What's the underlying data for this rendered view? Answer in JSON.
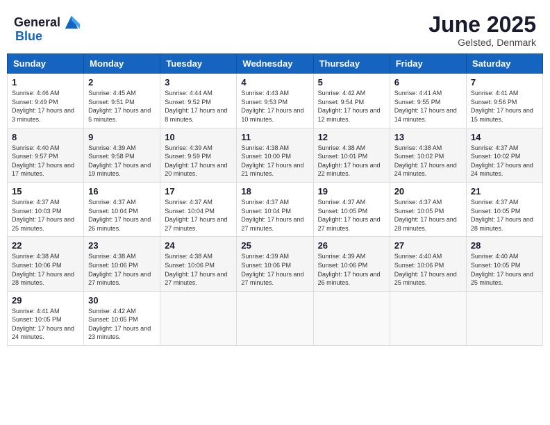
{
  "header": {
    "logo_general": "General",
    "logo_blue": "Blue",
    "month": "June 2025",
    "location": "Gelsted, Denmark"
  },
  "days_of_week": [
    "Sunday",
    "Monday",
    "Tuesday",
    "Wednesday",
    "Thursday",
    "Friday",
    "Saturday"
  ],
  "weeks": [
    [
      {
        "day": "1",
        "sunrise": "Sunrise: 4:46 AM",
        "sunset": "Sunset: 9:49 PM",
        "daylight": "Daylight: 17 hours and 3 minutes."
      },
      {
        "day": "2",
        "sunrise": "Sunrise: 4:45 AM",
        "sunset": "Sunset: 9:51 PM",
        "daylight": "Daylight: 17 hours and 5 minutes."
      },
      {
        "day": "3",
        "sunrise": "Sunrise: 4:44 AM",
        "sunset": "Sunset: 9:52 PM",
        "daylight": "Daylight: 17 hours and 8 minutes."
      },
      {
        "day": "4",
        "sunrise": "Sunrise: 4:43 AM",
        "sunset": "Sunset: 9:53 PM",
        "daylight": "Daylight: 17 hours and 10 minutes."
      },
      {
        "day": "5",
        "sunrise": "Sunrise: 4:42 AM",
        "sunset": "Sunset: 9:54 PM",
        "daylight": "Daylight: 17 hours and 12 minutes."
      },
      {
        "day": "6",
        "sunrise": "Sunrise: 4:41 AM",
        "sunset": "Sunset: 9:55 PM",
        "daylight": "Daylight: 17 hours and 14 minutes."
      },
      {
        "day": "7",
        "sunrise": "Sunrise: 4:41 AM",
        "sunset": "Sunset: 9:56 PM",
        "daylight": "Daylight: 17 hours and 15 minutes."
      }
    ],
    [
      {
        "day": "8",
        "sunrise": "Sunrise: 4:40 AM",
        "sunset": "Sunset: 9:57 PM",
        "daylight": "Daylight: 17 hours and 17 minutes."
      },
      {
        "day": "9",
        "sunrise": "Sunrise: 4:39 AM",
        "sunset": "Sunset: 9:58 PM",
        "daylight": "Daylight: 17 hours and 19 minutes."
      },
      {
        "day": "10",
        "sunrise": "Sunrise: 4:39 AM",
        "sunset": "Sunset: 9:59 PM",
        "daylight": "Daylight: 17 hours and 20 minutes."
      },
      {
        "day": "11",
        "sunrise": "Sunrise: 4:38 AM",
        "sunset": "Sunset: 10:00 PM",
        "daylight": "Daylight: 17 hours and 21 minutes."
      },
      {
        "day": "12",
        "sunrise": "Sunrise: 4:38 AM",
        "sunset": "Sunset: 10:01 PM",
        "daylight": "Daylight: 17 hours and 22 minutes."
      },
      {
        "day": "13",
        "sunrise": "Sunrise: 4:38 AM",
        "sunset": "Sunset: 10:02 PM",
        "daylight": "Daylight: 17 hours and 24 minutes."
      },
      {
        "day": "14",
        "sunrise": "Sunrise: 4:37 AM",
        "sunset": "Sunset: 10:02 PM",
        "daylight": "Daylight: 17 hours and 24 minutes."
      }
    ],
    [
      {
        "day": "15",
        "sunrise": "Sunrise: 4:37 AM",
        "sunset": "Sunset: 10:03 PM",
        "daylight": "Daylight: 17 hours and 25 minutes."
      },
      {
        "day": "16",
        "sunrise": "Sunrise: 4:37 AM",
        "sunset": "Sunset: 10:04 PM",
        "daylight": "Daylight: 17 hours and 26 minutes."
      },
      {
        "day": "17",
        "sunrise": "Sunrise: 4:37 AM",
        "sunset": "Sunset: 10:04 PM",
        "daylight": "Daylight: 17 hours and 27 minutes."
      },
      {
        "day": "18",
        "sunrise": "Sunrise: 4:37 AM",
        "sunset": "Sunset: 10:04 PM",
        "daylight": "Daylight: 17 hours and 27 minutes."
      },
      {
        "day": "19",
        "sunrise": "Sunrise: 4:37 AM",
        "sunset": "Sunset: 10:05 PM",
        "daylight": "Daylight: 17 hours and 27 minutes."
      },
      {
        "day": "20",
        "sunrise": "Sunrise: 4:37 AM",
        "sunset": "Sunset: 10:05 PM",
        "daylight": "Daylight: 17 hours and 28 minutes."
      },
      {
        "day": "21",
        "sunrise": "Sunrise: 4:37 AM",
        "sunset": "Sunset: 10:05 PM",
        "daylight": "Daylight: 17 hours and 28 minutes."
      }
    ],
    [
      {
        "day": "22",
        "sunrise": "Sunrise: 4:38 AM",
        "sunset": "Sunset: 10:06 PM",
        "daylight": "Daylight: 17 hours and 28 minutes."
      },
      {
        "day": "23",
        "sunrise": "Sunrise: 4:38 AM",
        "sunset": "Sunset: 10:06 PM",
        "daylight": "Daylight: 17 hours and 27 minutes."
      },
      {
        "day": "24",
        "sunrise": "Sunrise: 4:38 AM",
        "sunset": "Sunset: 10:06 PM",
        "daylight": "Daylight: 17 hours and 27 minutes."
      },
      {
        "day": "25",
        "sunrise": "Sunrise: 4:39 AM",
        "sunset": "Sunset: 10:06 PM",
        "daylight": "Daylight: 17 hours and 27 minutes."
      },
      {
        "day": "26",
        "sunrise": "Sunrise: 4:39 AM",
        "sunset": "Sunset: 10:06 PM",
        "daylight": "Daylight: 17 hours and 26 minutes."
      },
      {
        "day": "27",
        "sunrise": "Sunrise: 4:40 AM",
        "sunset": "Sunset: 10:06 PM",
        "daylight": "Daylight: 17 hours and 25 minutes."
      },
      {
        "day": "28",
        "sunrise": "Sunrise: 4:40 AM",
        "sunset": "Sunset: 10:05 PM",
        "daylight": "Daylight: 17 hours and 25 minutes."
      }
    ],
    [
      {
        "day": "29",
        "sunrise": "Sunrise: 4:41 AM",
        "sunset": "Sunset: 10:05 PM",
        "daylight": "Daylight: 17 hours and 24 minutes."
      },
      {
        "day": "30",
        "sunrise": "Sunrise: 4:42 AM",
        "sunset": "Sunset: 10:05 PM",
        "daylight": "Daylight: 17 hours and 23 minutes."
      },
      null,
      null,
      null,
      null,
      null
    ]
  ]
}
